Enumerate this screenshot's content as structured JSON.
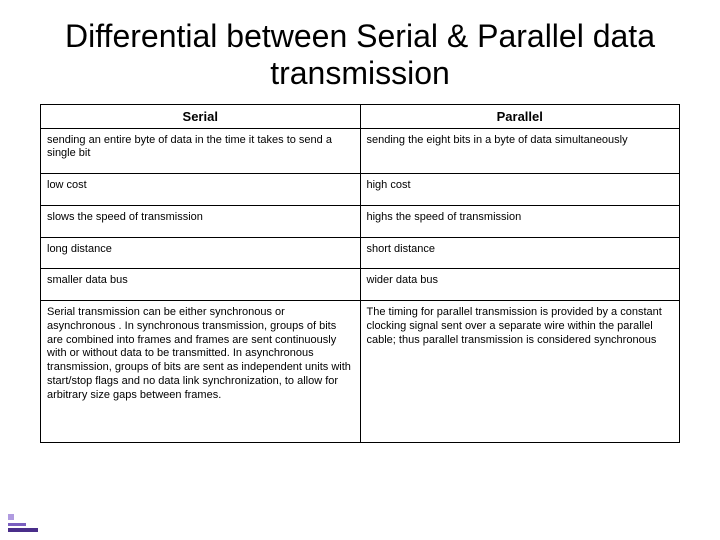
{
  "title": "Differential between Serial & Parallel data transmission",
  "headers": {
    "col1": "Serial",
    "col2": "Parallel"
  },
  "rows": [
    {
      "serial": "sending an entire byte of data in the time it takes to send a single bit",
      "parallel": "sending the eight bits in a byte of data simultaneously"
    },
    {
      "serial": "low cost",
      "parallel": "high cost"
    },
    {
      "serial": "slows the speed of transmission",
      "parallel": "highs the speed of transmission"
    },
    {
      "serial": "long distance",
      "parallel": "short distance"
    },
    {
      "serial": "smaller data bus",
      "parallel": "wider data bus"
    },
    {
      "serial": "Serial transmission can be either synchronous or asynchronous . In synchronous transmission, groups of bits are combined into frames and frames are sent continuously with or without data to be transmitted. In asynchronous transmission, groups of bits are sent as independent units with start/stop flags and no data link synchronization, to allow for arbitrary size gaps between frames.",
      "parallel": "The timing for parallel transmission is provided by a constant clocking signal sent over a separate wire\nwithin the parallel cable; thus parallel transmission is considered synchronous"
    }
  ],
  "chart_data": {
    "type": "table",
    "title": "Differential between Serial & Parallel data transmission",
    "columns": [
      "Serial",
      "Parallel"
    ],
    "rows": [
      [
        "sending an entire byte of data in the time it takes to send a single bit",
        "sending the eight bits in a byte of data simultaneously"
      ],
      [
        "low cost",
        "high cost"
      ],
      [
        "slows the speed of transmission",
        "highs the speed of transmission"
      ],
      [
        "long distance",
        "short distance"
      ],
      [
        "smaller data bus",
        "wider data bus"
      ],
      [
        "Serial transmission can be either synchronous or asynchronous . In synchronous transmission, groups of bits are combined into frames and frames are sent continuously with or without data to be transmitted. In asynchronous transmission, groups of bits are sent as independent units with start/stop flags and no data link synchronization, to allow for arbitrary size gaps between frames.",
        "The timing for parallel transmission is provided by a constant clocking signal sent over a separate wire within the parallel cable; thus parallel transmission is considered synchronous"
      ]
    ]
  }
}
